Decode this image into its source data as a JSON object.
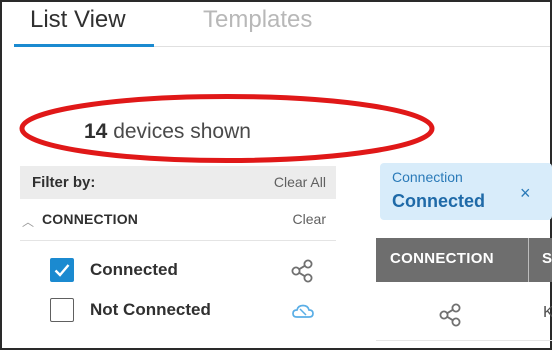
{
  "tabs": [
    {
      "label": "List View",
      "active": true
    },
    {
      "label": "Templates",
      "active": false
    }
  ],
  "device_count": {
    "number": "14",
    "text": "devices shown"
  },
  "filter": {
    "title": "Filter by:",
    "clear_all": "Clear All",
    "section": {
      "title": "CONNECTION",
      "clear": "Clear",
      "options": [
        {
          "label": "Connected",
          "checked": true,
          "icon": "connected-nodes-icon"
        },
        {
          "label": "Not Connected",
          "checked": false,
          "icon": "cloud-offline-icon"
        }
      ]
    }
  },
  "active_filter_chip": {
    "key": "Connection",
    "value": "Connected",
    "remove": "×"
  },
  "table": {
    "columns": [
      "CONNECTION",
      "S"
    ],
    "rows": [
      {
        "connection_icon": "connected-nodes-icon",
        "next_cell_fragment": "K"
      }
    ]
  },
  "colors": {
    "accent": "#1b8ad0",
    "highlight": "#e01818",
    "chip_bg": "#d8ecfa",
    "header_bg": "#6e6e6e"
  }
}
